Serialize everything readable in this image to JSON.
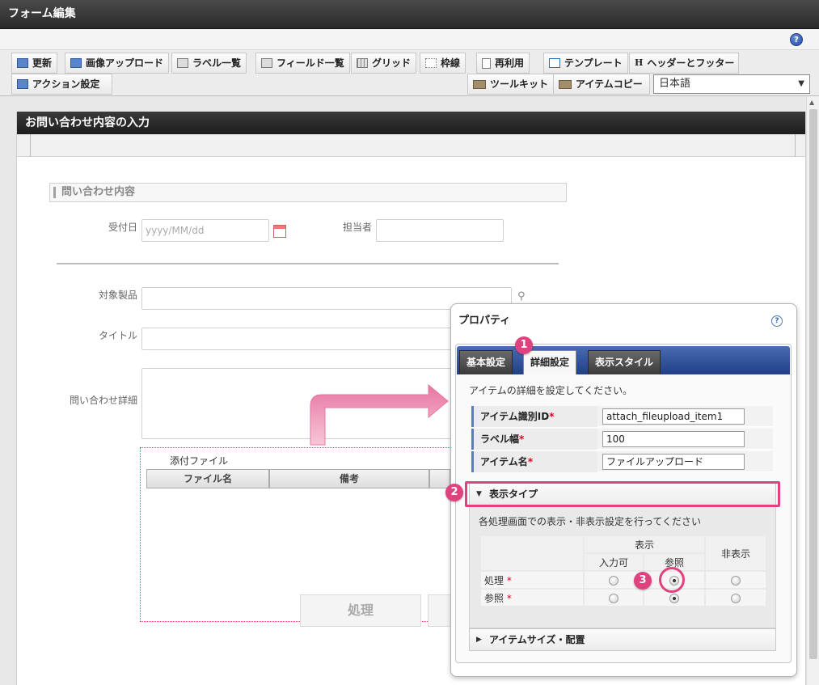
{
  "window": {
    "title": "フォーム編集"
  },
  "help_label": "?",
  "toolbar": {
    "row1": [
      {
        "label": "更新",
        "icon": "refresh-icon"
      },
      {
        "label": "画像アップロード",
        "icon": "image-upload-icon"
      },
      {
        "label": "ラベル一覧",
        "icon": "label-list-icon"
      },
      {
        "label": "フィールド一覧",
        "icon": "field-list-icon"
      },
      {
        "label": "グリッド",
        "icon": "grid-icon"
      },
      {
        "label": "枠線",
        "icon": "border-icon"
      },
      {
        "label": "再利用",
        "icon": "reuse-icon"
      },
      {
        "label": "テンプレート",
        "icon": "template-icon"
      },
      {
        "label": "ヘッダーとフッター",
        "icon": "header-footer-icon",
        "glyph": "H"
      }
    ],
    "row2_left": {
      "label": "アクション設定",
      "icon": "action-icon"
    },
    "row2_right": [
      {
        "label": "ツールキット",
        "icon": "toolkit-icon"
      },
      {
        "label": "アイテムコピー",
        "icon": "item-copy-icon"
      }
    ],
    "language": {
      "value": "日本語",
      "caret": "▼"
    }
  },
  "canvas": {
    "title": "お問い合わせ内容の入力",
    "section_title": "問い合わせ内容",
    "fields": {
      "received_date": {
        "label": "受付日",
        "placeholder": "yyyy/MM/dd"
      },
      "assignee": {
        "label": "担当者"
      },
      "product": {
        "label": "対象製品"
      },
      "title": {
        "label": "タイトル"
      },
      "detail": {
        "label": "問い合わせ詳細"
      }
    },
    "attachment": {
      "title": "添付ファイル",
      "columns": [
        "ファイル名",
        "備考"
      ]
    },
    "process_button": "処理"
  },
  "properties": {
    "title": "プロパティ",
    "help": "?",
    "tabs": [
      "基本設定",
      "詳細設定",
      "表示スタイル"
    ],
    "active_tab": 1,
    "description": "アイテムの詳細を設定してください。",
    "rows": [
      {
        "label": "アイテム識別ID",
        "required": "*",
        "value": "attach_fileupload_item1"
      },
      {
        "label": "ラベル幅",
        "required": "*",
        "value": "100"
      },
      {
        "label": "アイテム名",
        "required": "*",
        "value": "ファイルアップロード"
      }
    ],
    "display_type": {
      "label": "表示タイプ",
      "arrow": "▼",
      "description": "各処理画面での表示・非表示設定を行ってください",
      "header_display": "表示",
      "header_hidden": "非表示",
      "col_input": "入力可",
      "col_ref": "参照",
      "rows": [
        {
          "label": "処理",
          "required": "*",
          "selected": "参照"
        },
        {
          "label": "参照",
          "required": "*",
          "selected": "参照"
        }
      ]
    },
    "item_size": {
      "label": "アイテムサイズ・配置",
      "arrow": "▶"
    }
  },
  "callouts": [
    "1",
    "2",
    "3"
  ],
  "colors": {
    "accent": "#e0427f",
    "tab_bar": "#2d4f99",
    "title_bar": "#333333"
  }
}
